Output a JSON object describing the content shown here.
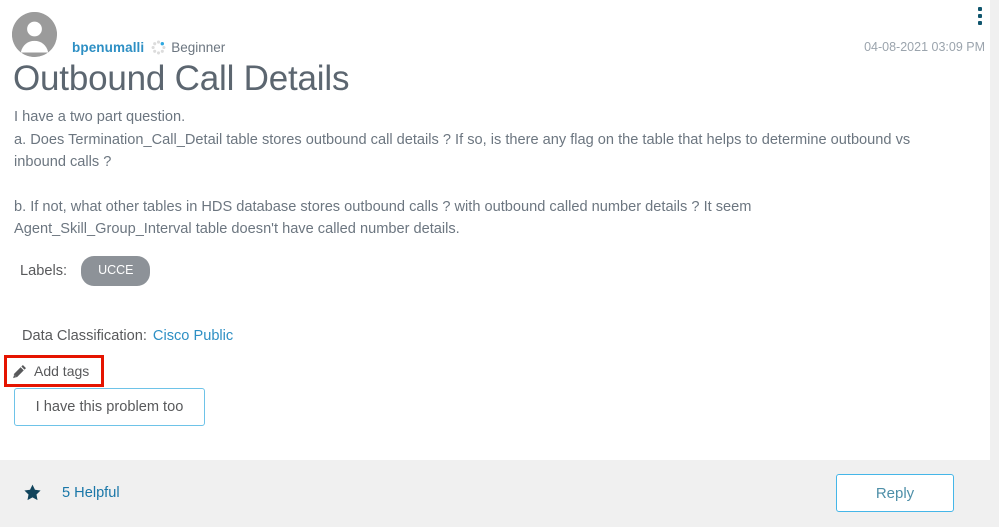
{
  "post": {
    "author": "bpenumalli",
    "rank": "Beginner",
    "rank_badge_icon": "rank-ring-icon",
    "avatar_icon": "user-avatar-icon",
    "timestamp": "04-08-2021 03:09 PM",
    "kebab_icon": "more-options-icon",
    "subject": "Outbound Call Details",
    "body_paragraphs": [
      "I have a two part question.",
      "a. Does Termination_Call_Detail table stores outbound call details ? If so, is there any flag on the table that helps to determine outbound vs inbound calls ?",
      "b. If not, what other tables in HDS database stores outbound calls ? with outbound called number details ? It seem Agent_Skill_Group_Interval table doesn't have called number details."
    ]
  },
  "labels": {
    "caption": "Labels:",
    "items": [
      "UCCE"
    ]
  },
  "classification": {
    "caption": "Data Classification:",
    "value": "Cisco Public"
  },
  "tags": {
    "add_label": "Add tags",
    "pencil_icon": "pencil-icon",
    "highlight_color": "#e51400"
  },
  "actions": {
    "problem_label": "I have this problem too",
    "reply_label": "Reply"
  },
  "footer": {
    "star_icon": "star-icon",
    "helpful_label": "5 Helpful"
  },
  "colors": {
    "link": "#2d8fc4",
    "title": "#5c6670",
    "body": "#6c7680",
    "pill": "#8d9298",
    "footer_bg": "#f0f0f0",
    "annotation": "#e51400",
    "kebab": "#10566e",
    "star": "#11445c"
  }
}
